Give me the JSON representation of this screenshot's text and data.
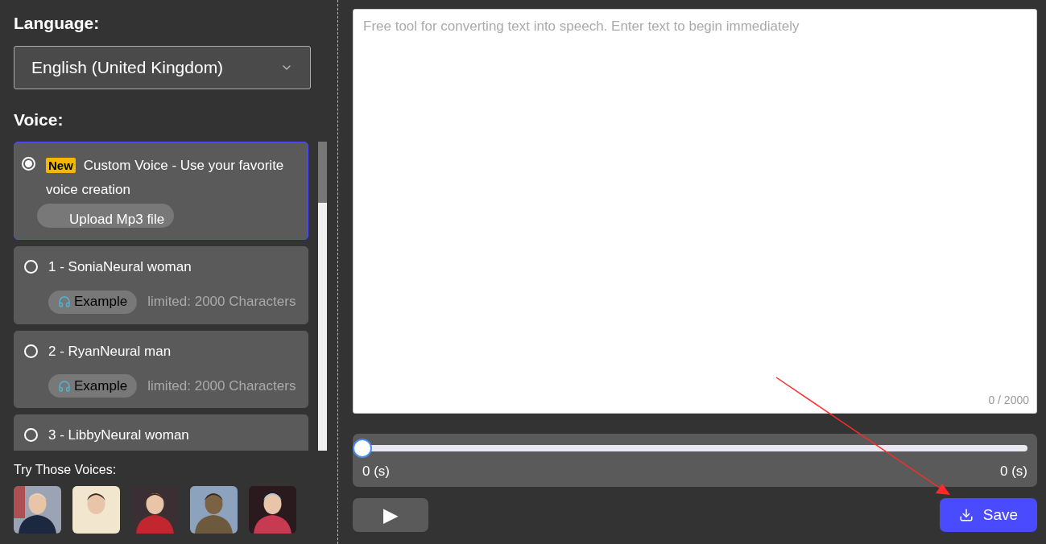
{
  "language": {
    "label": "Language:",
    "value": "English (United Kingdom)"
  },
  "voice": {
    "label": "Voice:",
    "items": [
      {
        "kind": "custom",
        "selected": true,
        "badge": "New",
        "title": "Custom Voice - Use your favorite voice creation",
        "action": "Upload Mp3 file"
      },
      {
        "kind": "standard",
        "selected": false,
        "title": "1 - SoniaNeural woman",
        "action": "Example",
        "note": "limited: 2000 Characters"
      },
      {
        "kind": "standard",
        "selected": false,
        "title": "2 - RyanNeural man",
        "action": "Example",
        "note": "limited: 2000 Characters"
      },
      {
        "kind": "standard",
        "selected": false,
        "title": "3 - LibbyNeural woman"
      }
    ]
  },
  "try_voices": {
    "label": "Try Those Voices:"
  },
  "editor": {
    "placeholder": "Free tool for converting text into speech. Enter text to begin immediately",
    "counter": "0 / 2000"
  },
  "player": {
    "level": 0,
    "start": "0 (s)",
    "end": "0 (s)",
    "play": "▶",
    "save": "Save"
  }
}
